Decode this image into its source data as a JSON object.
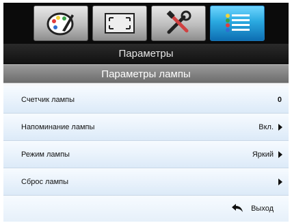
{
  "menu": {
    "title": "Параметры",
    "subtitle": "Параметры лампы"
  },
  "tabs": [
    {
      "name": "palette",
      "active": false
    },
    {
      "name": "screen",
      "active": false
    },
    {
      "name": "tools",
      "active": false
    },
    {
      "name": "list",
      "active": true
    }
  ],
  "rows": [
    {
      "label": "Счетчик лампы",
      "value": "0"
    },
    {
      "label": "Напоминание лампы",
      "value": "Вкл."
    },
    {
      "label": "Режим лампы",
      "value": "Яркий"
    },
    {
      "label": "Сброс лампы",
      "value": ""
    }
  ],
  "exit": {
    "label": "Выход"
  },
  "colors": {
    "active_tab": "#2aa9e0",
    "row_bg": "#dceaf8",
    "header_bg": "#111111"
  }
}
